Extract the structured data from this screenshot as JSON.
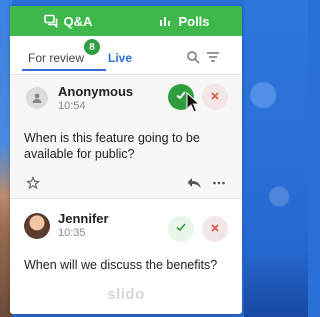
{
  "tabs": [
    {
      "label": "Q&A",
      "icon": "chat-bubbles-icon",
      "active": true
    },
    {
      "label": "Polls",
      "icon": "bar-chart-icon",
      "active": false
    }
  ],
  "subnav": {
    "review_label": "For review",
    "review_count": "8",
    "live_label": "Live",
    "search_icon": "search-icon",
    "filter_icon": "filter-icon"
  },
  "questions": [
    {
      "author": "Anonymous",
      "time": "10:54",
      "text": "When is this feature going to be available for public?",
      "avatar": "anonymous-user-icon"
    },
    {
      "author": "Jennifer",
      "time": "10:35",
      "text": "When will we discuss the benefits?",
      "avatar": "user-photo"
    }
  ],
  "footer": {
    "brand": "slido"
  },
  "colors": {
    "brand_green": "#3eb84a",
    "approve_green": "#2f9e3e",
    "reject_red": "#d9534f",
    "accent_blue": "#2f6fd0"
  }
}
